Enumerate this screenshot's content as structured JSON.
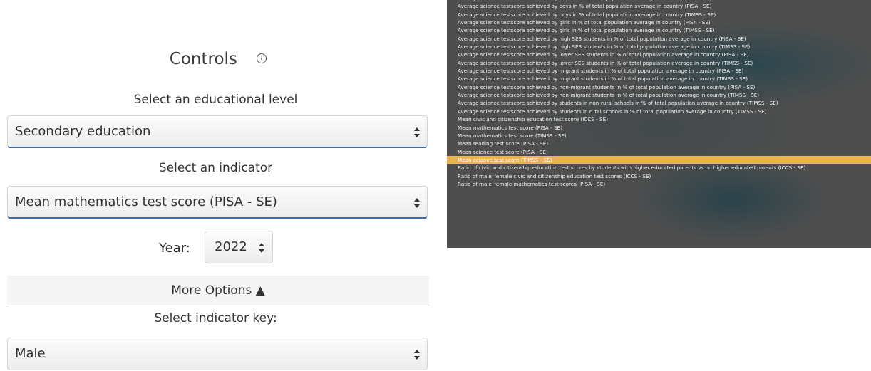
{
  "controls": {
    "title": "Controls",
    "info_glyph": "i",
    "level_label": "Select an educational level",
    "level_value": "Secondary education",
    "indicator_label": "Select an indicator",
    "indicator_value": "Mean mathematics test score (PISA - SE)",
    "year_label": "Year:",
    "year_value": "2022",
    "more_options_label": "More Options ▲",
    "key_label": "Select indicator key:",
    "key_value": "Male"
  },
  "dropdown": {
    "selected_index": 20,
    "items": [
      "Average science testscore achieved by boys in % of total population average in country (PISA - SE)",
      "Average science testscore achieved by boys in % of total population average in country (PISA - SE)",
      "Average science testscore achieved by boys in % of total population average in country (TIMSS - SE)",
      "Average science testscore achieved by girls in % of total population average in country (PISA - SE)",
      "Average science testscore achieved by girls in % of total population average in country (TIMSS - SE)",
      "Average science testscore achieved by high SES students in % of total population average in country (PISA - SE)",
      "Average science testscore achieved by high SES students in % of total population average in country (TIMSS - SE)",
      "Average science testscore achieved by lower SES students in % of total population average in country (PISA - SE)",
      "Average science testscore achieved by lower SES students in % of total population average in country (TIMSS - SE)",
      "Average science testscore achieved by migrant students in % of total population average in country (PISA - SE)",
      "Average science testscore achieved by migrant students in % of total population average in country (TIMSS - SE)",
      "Average science testscore achieved by non-migrant students in % of total population average in country (PISA - SE)",
      "Average science testscore achieved by non-migrant students in % of total population average in country (TIMSS - SE)",
      "Average science testscore achieved by students in non-rural schools in % of total population average in country (TIMSS - SE)",
      "Average science testscore achieved by students in rural schools in % of total population average in country (TIMSS - SE)",
      "Mean civic and citizenship education test score (ICCS - SE)",
      "Mean mathematics test score (PISA - SE)",
      "Mean mathematics test score (TIMSS - SE)",
      "Mean reading test score (PISA - SE)",
      "Mean science test score (PISA - SE)",
      "Mean science test score (TIMSS - SE)",
      "Ratio of civic and citizenship education test scores by students with higher educated parents vs no higher educated parents (ICCS - SE)",
      "Ratio of male_female civic and citizenship education test scores (ICCS - SE)",
      "Ratio of male_female mathematics test scores (PISA - SE)"
    ]
  },
  "colors": {
    "selected_item": "#e8b44c",
    "focus_border": "#3b6aa8",
    "menu_background": "#4e4e4e"
  }
}
